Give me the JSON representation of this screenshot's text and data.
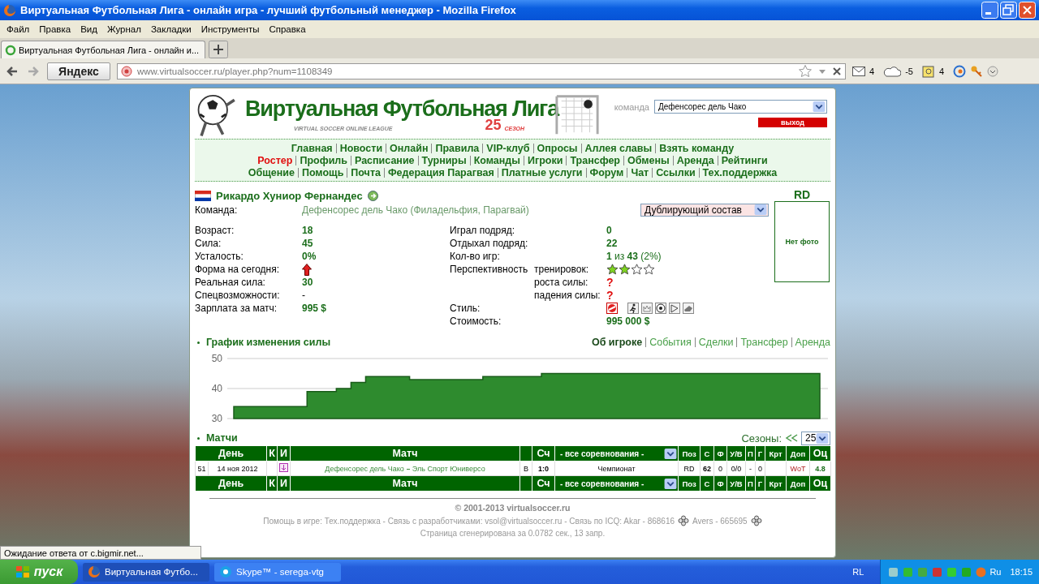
{
  "window": {
    "title": "Виртуальная Футбольная Лига - онлайн игра - лучший футбольный менеджер - Mozilla Firefox"
  },
  "menu": [
    "Файл",
    "Правка",
    "Вид",
    "Журнал",
    "Закладки",
    "Инструменты",
    "Справка"
  ],
  "tabs": [
    {
      "label": "Виртуальная Футбольная Лига - онлайн и...",
      "selected": true
    }
  ],
  "toolbar": {
    "search_engine": "Яндекс",
    "url": "www.virtualsoccer.ru/player.php?num=1108349",
    "mail_count": "4",
    "weather": "-5",
    "notes_count": "4"
  },
  "site": {
    "logo_title": "Виртуальная Футбольная Лига",
    "logo_subtitle": "VIRTUAL SOCCER ONLINE LEAGUE",
    "season_number": "25",
    "season_label": "СЕЗОН",
    "team_label": "команда",
    "team_select": "Дефенсорес дель Чако",
    "logout": "выход"
  },
  "nav_rows": [
    [
      {
        "label": "Главная",
        "selected": false
      },
      {
        "label": "Новости",
        "selected": false
      },
      {
        "label": "Онлайн",
        "selected": false
      },
      {
        "label": "Правила",
        "selected": false
      },
      {
        "label": "VIP-клуб",
        "selected": false
      },
      {
        "label": "Опросы",
        "selected": false
      },
      {
        "label": "Аллея славы",
        "selected": false
      },
      {
        "label": "Взять команду",
        "selected": false
      }
    ],
    [
      {
        "label": "Ростер",
        "selected": true
      },
      {
        "label": "Профиль",
        "selected": false
      },
      {
        "label": "Расписание",
        "selected": false
      },
      {
        "label": "Турниры",
        "selected": false
      },
      {
        "label": "Команды",
        "selected": false
      },
      {
        "label": "Игроки",
        "selected": false
      },
      {
        "label": "Трансфер",
        "selected": false
      },
      {
        "label": "Обмены",
        "selected": false
      },
      {
        "label": "Аренда",
        "selected": false
      },
      {
        "label": "Рейтинги",
        "selected": false
      }
    ],
    [
      {
        "label": "Общение",
        "selected": false
      },
      {
        "label": "Помощь",
        "selected": false
      },
      {
        "label": "Почта",
        "selected": false
      },
      {
        "label": "Федерация Парагвая",
        "selected": false
      },
      {
        "label": "Платные услуги",
        "selected": false
      },
      {
        "label": "Форум",
        "selected": false
      },
      {
        "label": "Чат",
        "selected": false
      },
      {
        "label": "Ссылки",
        "selected": false
      },
      {
        "label": "Тех.поддержка",
        "selected": false
      }
    ]
  ],
  "player": {
    "name": "Рикардо Хуниор Фернандес",
    "position": "RD",
    "team_label": "Команда:",
    "team": "Дефенсорес дель Чако (Филадельфия, Парагвай)",
    "squad_select": "Дублирующий состав",
    "photo": "Нет фото",
    "left_stats": [
      {
        "kind": "text",
        "label": "Возраст:",
        "value": "18"
      },
      {
        "kind": "text",
        "label": "Сила:",
        "value": "45"
      },
      {
        "kind": "text",
        "label": "Усталость:",
        "value": "0%"
      },
      {
        "kind": "form-up",
        "label": "Форма на сегодня:"
      },
      {
        "kind": "text",
        "label": "Реальная сила:",
        "value": "30"
      },
      {
        "kind": "plain",
        "label": "Спецвозможности:",
        "value": "-"
      },
      {
        "kind": "text",
        "label": "Зарплата за матч:",
        "value": "995 $"
      }
    ],
    "right_stats": [
      {
        "kind": "text",
        "label": "Играл подряд:",
        "value": "0"
      },
      {
        "kind": "text",
        "label": "Отдыхал подряд:",
        "value": "22"
      },
      {
        "kind": "rich",
        "label": "Кол-во игр:",
        "value": "**1** из **43** (2%)"
      },
      {
        "kind": "stars",
        "label": "Перспективность",
        "sub": "тренировок:",
        "stars": 2
      },
      {
        "kind": "unknown",
        "sub": "роста силы:",
        "value": "?"
      },
      {
        "kind": "unknown",
        "sub": "падения силы:",
        "value": "?"
      },
      {
        "kind": "styles",
        "label": "Стиль:",
        "styles": [
          {
            "selected": true
          },
          {
            "selected": false
          },
          {
            "selected": false
          },
          {
            "selected": false
          },
          {
            "selected": false
          },
          {
            "selected": false
          }
        ]
      },
      {
        "kind": "text",
        "label": "Стоимость:",
        "value": "995 000 $"
      }
    ]
  },
  "chart_section": {
    "title": "График изменения силы",
    "links": [
      {
        "label": "Об игроке",
        "selected": true
      },
      {
        "label": "События",
        "selected": false
      },
      {
        "label": "Сделки",
        "selected": false
      },
      {
        "label": "Трансфер",
        "selected": false
      },
      {
        "label": "Аренда",
        "selected": false
      }
    ],
    "chart_data": {
      "type": "area",
      "ylim": [
        30,
        50
      ],
      "yticks": [
        30,
        40,
        50
      ],
      "series": [
        {
          "color": "#2e8b2e",
          "values": [
            34,
            34,
            34,
            34,
            34,
            39,
            39,
            40,
            42,
            44,
            44,
            44,
            43,
            43,
            43,
            43,
            43,
            44,
            44,
            44,
            44,
            45,
            45,
            45,
            45,
            45,
            45,
            45,
            45,
            45,
            45,
            45,
            45,
            45,
            45,
            45,
            45,
            45,
            45,
            45,
            45
          ]
        }
      ]
    }
  },
  "matches": {
    "title": "Матчи",
    "seasons_label": "Сезоны:",
    "season_select": "25",
    "columns": [
      "День",
      "К",
      "И",
      "Матч",
      "Сч",
      "Поз",
      "С",
      "Ф",
      "У/В",
      "П",
      "Г",
      "Крт",
      "Доп",
      "Оц"
    ],
    "competition_filter": "- все соревнования -",
    "rows": [
      {
        "round": "51",
        "date": "14 ноя 2012",
        "home": "Дефенсорес дель Чако",
        "away": "Эль Спорт Юниверсо",
        "venue": "В",
        "score": "1:0",
        "tournament": "Чемпионат",
        "position": "RD",
        "c": "62",
        "f": "0",
        "uv": "0/0",
        "p": "-",
        "g": "0",
        "extra": "WoT",
        "rating": "4.8"
      }
    ],
    "footer_columns": [
      "День",
      "К",
      "И",
      "Матч",
      "Сч",
      "Поз",
      "С",
      "Ф",
      "У/В",
      "П",
      "Г",
      "Крт",
      "Доп",
      "Оц"
    ],
    "footer_filter": "- все соревнования -"
  },
  "footer": {
    "copyright": "© 2001-2013 virtualsoccer.ru",
    "help": "Помощь в игре: Тех.поддержка - Связь с разработчиками: vsol@virtualsoccer.ru - Связь по ICQ: Akar - 868616",
    "icq2": "Avers - 665695",
    "generated": "Страница сгенерирована за 0.0782 сек., 13 запр."
  },
  "status": "Ожидание ответа от c.bigmir.net...",
  "taskbar": {
    "start": "пуск",
    "tasks": [
      {
        "label": "Виртуальная Футбо...",
        "selected": true
      },
      {
        "label": "Skype™ - serega-vtg",
        "selected": false
      }
    ],
    "lang": "RL",
    "tray_lang": "Ru",
    "clock": "18:15"
  }
}
